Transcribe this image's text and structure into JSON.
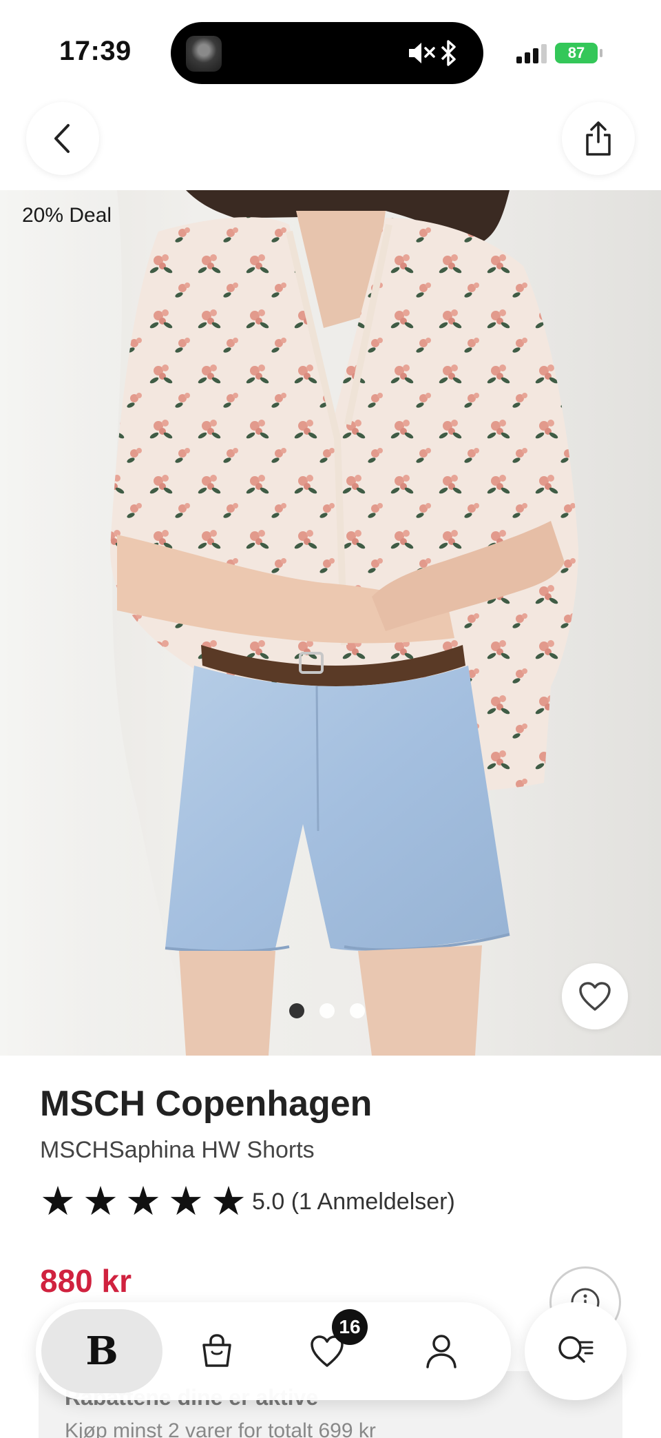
{
  "status_bar": {
    "time": "17:39",
    "battery": "87"
  },
  "header": {
    "back_icon": "chevron-left-icon",
    "share_icon": "share-icon"
  },
  "hero": {
    "deal_tag": "20% Deal",
    "image_count": 3,
    "active_image": 1,
    "favorite_icon": "heart-icon"
  },
  "product": {
    "brand": "MSCH Copenhagen",
    "name": "MSCHSaphina HW Shorts",
    "rating_stars": 5,
    "rating_text": "5.0 (1 Anmeldelser)",
    "price": "880 kr",
    "price_color": "#d0223f"
  },
  "promo": {
    "title": "Rabattene dine er aktive",
    "subtitle": "Kjøp minst 2 varer for totalt 699 kr"
  },
  "nav": {
    "home_logo": "B",
    "bag_icon": "shopping-bag-icon",
    "favorites_icon": "heart-icon",
    "favorites_count": "16",
    "account_icon": "user-icon",
    "search_icon": "search-menu-icon"
  }
}
